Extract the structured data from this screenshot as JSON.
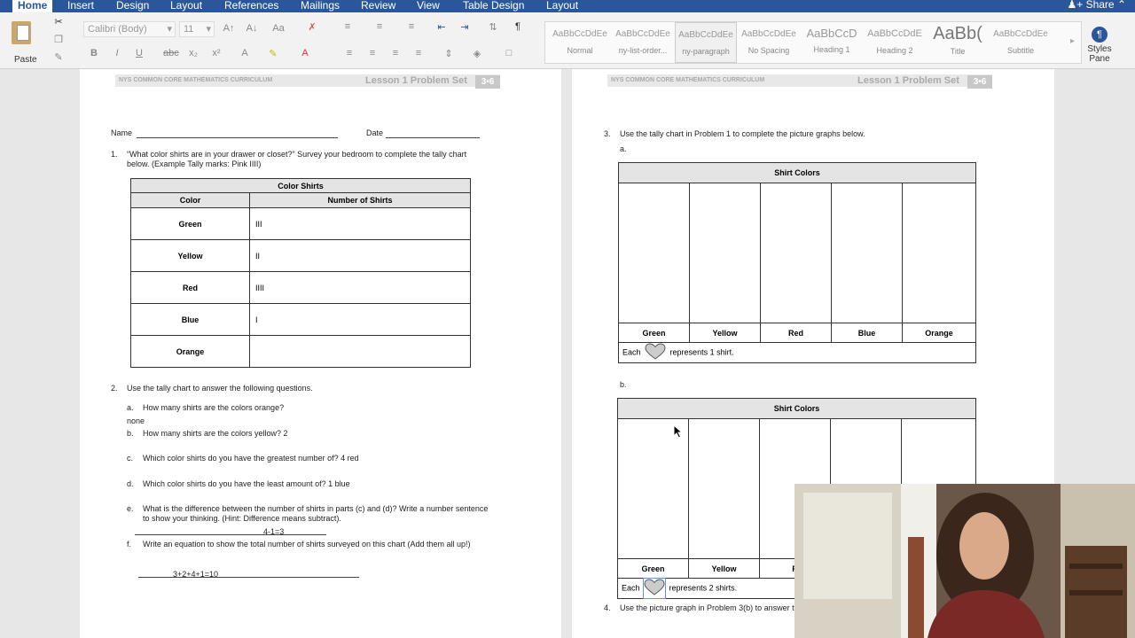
{
  "ribbon_tabs": [
    "Home",
    "Insert",
    "Design",
    "Layout",
    "References",
    "Mailings",
    "Review",
    "View",
    "Table Design",
    "Layout"
  ],
  "share": "Share",
  "paste": "Paste",
  "font": {
    "name": "Calibri (Body)",
    "size": "11"
  },
  "styles": [
    {
      "preview": "AaBbCcDdEe",
      "name": "Normal"
    },
    {
      "preview": "AaBbCcDdEe",
      "name": "ny-list-order..."
    },
    {
      "preview": "AaBbCcDdEe",
      "name": "ny-paragraph"
    },
    {
      "preview": "AaBbCcDdEe",
      "name": "No Spacing"
    },
    {
      "preview": "AaBbCcD",
      "name": "Heading 1"
    },
    {
      "preview": "AaBbCcDdE",
      "name": "Heading 2"
    },
    {
      "preview": "AaBb(",
      "name": "Title"
    },
    {
      "preview": "AaBbCcDdEe",
      "name": "Subtitle"
    }
  ],
  "styles_pane": [
    "Styles",
    "Pane"
  ],
  "header": {
    "left": "NYS COMMON CORE MATHEMATICS CURRICULUM",
    "right": "Lesson 1 Problem Set",
    "badge": "3•6"
  },
  "p1": {
    "name_label": "Name",
    "date_label": "Date",
    "q1_num": "1.",
    "q1_line1": "“What color shirts are in your drawer or closet?”  Survey your bedroom to complete the tally chart",
    "q1_line2": "below. (Example Tally marks: Pink IIII)",
    "tally_title": "Color Shirts",
    "col_color": "Color",
    "col_number": "Number of Shirts",
    "rows": [
      {
        "color": "Green",
        "tally": "III"
      },
      {
        "color": "Yellow",
        "tally": "II"
      },
      {
        "color": "Red",
        "tally": "IIII"
      },
      {
        "color": "Blue",
        "tally": "I"
      },
      {
        "color": "Orange",
        "tally": ""
      }
    ],
    "q2_num": "2.",
    "q2": "Use the tally chart to answer the following questions.",
    "a": "a.",
    "a_q": "How many shirts are the colors orange?",
    "a_ans": "none",
    "b": "b.",
    "b_q": "How many shirts are the colors yellow? 2",
    "c": "c.",
    "c_q": "Which color shirts do you have the greatest number of?  4 red",
    "d": "d.",
    "d_q": "Which color shirts do you have the least amount of?  1 blue",
    "e": "e.",
    "e_q1": "What is the difference between the number of shirts in parts (c) and (d)?  Write a number sentence",
    "e_q2": "to show your thinking. (Hint: Difference means subtract).",
    "e_ans": "4-1=3",
    "f": "f.",
    "f_q": "Write an equation to show the total number of shirts surveyed on this chart (Add them all up!)",
    "f_ans": "3+2+4+1=10"
  },
  "p2": {
    "q3_num": "3.",
    "q3": "Use the tally chart in Problem 1 to complete the picture graphs below.",
    "a": "a.",
    "b": "b.",
    "graph_title": "Shirt Colors",
    "cols": [
      "Green",
      "Yellow",
      "Red",
      "Blue",
      "Orange"
    ],
    "cols_b": [
      "Green",
      "Yellow",
      "R"
    ],
    "each": "Each",
    "key_a": "represents 1 shirt.",
    "key_b": "represents 2 shirts.",
    "q4_num": "4.",
    "q4": "Use the picture graph in Problem 3(b) to answer t"
  }
}
